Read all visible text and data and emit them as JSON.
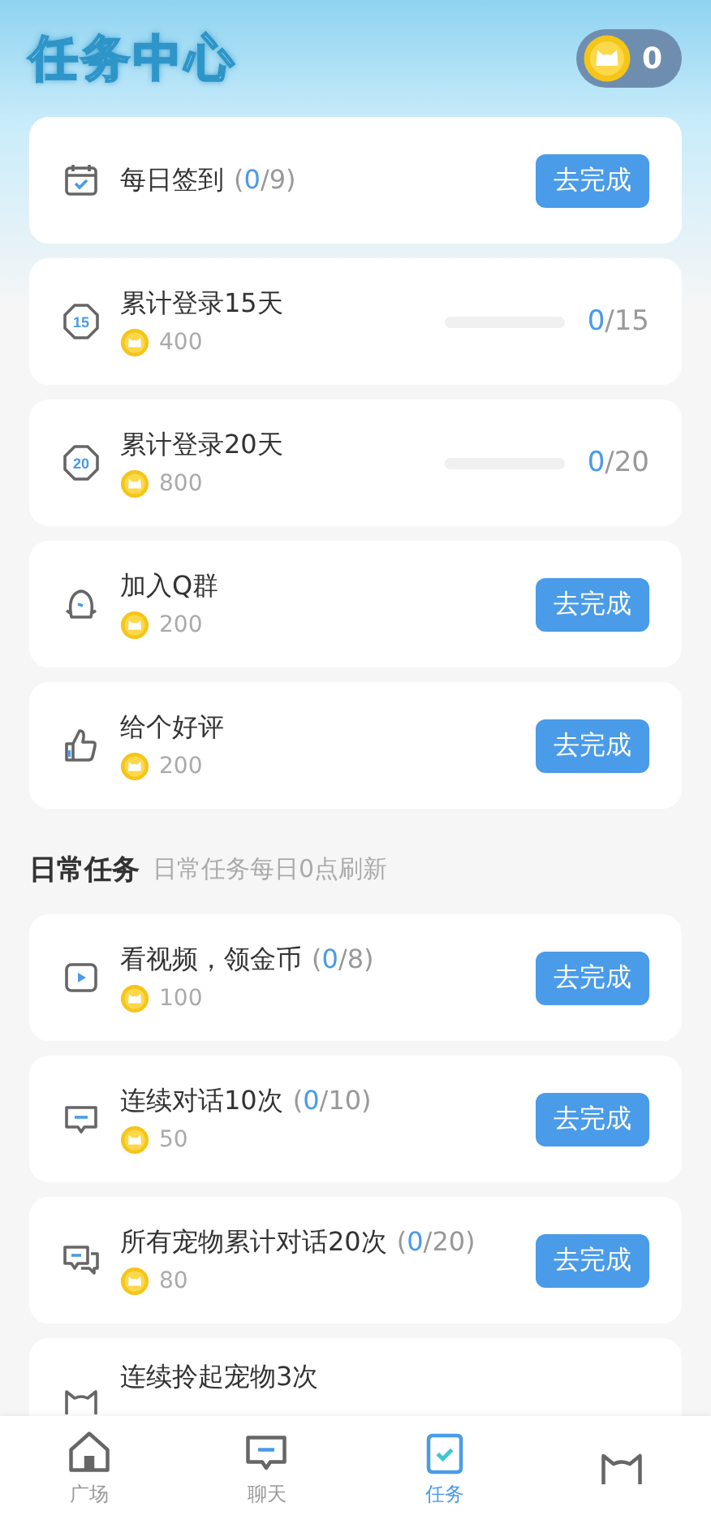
{
  "header": {
    "title": "任务中心",
    "coins": "0"
  },
  "tasks": [
    {
      "title": "每日签到",
      "count": {
        "prefix": "(",
        "done": "0",
        "suffix": "/9)"
      },
      "action": {
        "kind": "button",
        "label": "去完成"
      }
    },
    {
      "badge": "15",
      "title": "累计登录15天",
      "reward": "400",
      "action": {
        "kind": "progress",
        "level": 0,
        "done": "0",
        "total": "/15"
      }
    },
    {
      "badge": "20",
      "title": "累计登录20天",
      "reward": "800",
      "action": {
        "kind": "progress",
        "level": 0,
        "done": "0",
        "total": "/20"
      }
    },
    {
      "title": "加入Q群",
      "reward": "200",
      "action": {
        "kind": "button",
        "label": "去完成"
      }
    },
    {
      "title": "给个好评",
      "reward": "200",
      "action": {
        "kind": "button",
        "label": "去完成"
      }
    }
  ],
  "daily": {
    "title": "日常任务",
    "note": "日常任务每日0点刷新",
    "tasks": [
      {
        "title": "看视频，领金币",
        "count": {
          "prefix": "(",
          "done": "0",
          "suffix": "/8)"
        },
        "reward": "100",
        "action": {
          "kind": "button",
          "label": "去完成"
        }
      },
      {
        "title": "连续对话10次",
        "count": {
          "prefix": "(",
          "done": "0",
          "suffix": "/10)"
        },
        "reward": "50",
        "action": {
          "kind": "button",
          "label": "去完成"
        }
      },
      {
        "title": "所有宠物累计对话20次",
        "count": {
          "prefix": "(",
          "done": "0",
          "suffix": "/20)"
        },
        "reward": "80",
        "action": {
          "kind": "button",
          "label": "去完成"
        }
      },
      {
        "title": "连续拎起宠物3次"
      }
    ]
  },
  "nav": [
    {
      "label": "广场",
      "selected": false
    },
    {
      "label": "聊天",
      "selected": false
    },
    {
      "label": "任务",
      "selected": true
    },
    {
      "selected": false
    }
  ]
}
